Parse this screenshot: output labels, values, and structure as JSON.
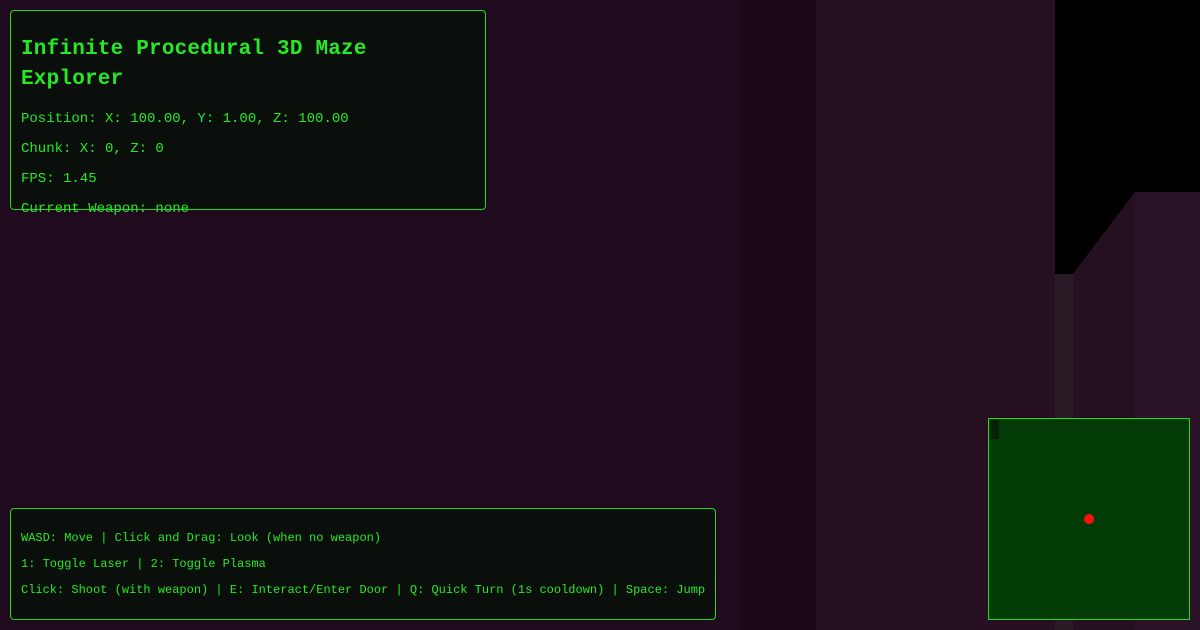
{
  "hud": {
    "title": "Infinite Procedural 3D Maze Explorer",
    "position_line": "Position: X: 100.00, Y: 1.00, Z: 100.00",
    "chunk_line": "Chunk: X: 0, Z: 0",
    "fps_line": "FPS: 1.45",
    "weapon_line": "Current Weapon: none"
  },
  "controls": {
    "line1": "WASD: Move | Click and Drag: Look (when no weapon)",
    "line2": "1: Toggle Laser | 2: Toggle Plasma",
    "line3": "Click: Shoot (with weapon) | E: Interact/Enter Door | Q: Quick Turn (1s cooldown) | Space: Jump"
  },
  "colors": {
    "hud_text": "#27e827",
    "hud_border": "#22d822",
    "scene_wall": "#1f0a1e",
    "minimap_bg": "#033b06",
    "player_marker": "#ff1010"
  },
  "icons": {
    "player_marker": "red-dot"
  }
}
